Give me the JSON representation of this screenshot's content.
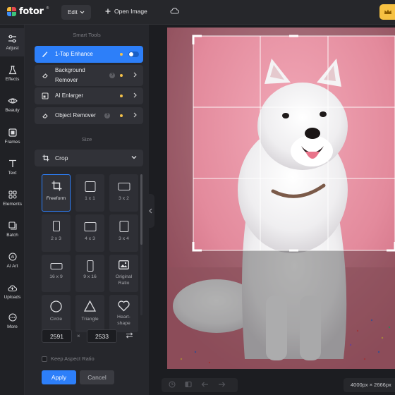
{
  "app": {
    "logo_text": "fotor",
    "logo_reg": "®",
    "logo_colors": [
      "#f5b93d",
      "#e5484d",
      "#3d8ef8",
      "#3ec57a"
    ]
  },
  "topbar": {
    "edit_label": "Edit",
    "open_image_label": "Open Image",
    "cloud_icon": "cloud-icon",
    "pro_color": "#f6c142"
  },
  "rail": {
    "items": [
      {
        "label": "Adjust",
        "icon": "sliders-icon"
      },
      {
        "label": "Effects",
        "icon": "flask-icon"
      },
      {
        "label": "Beauty",
        "icon": "eye-icon"
      },
      {
        "label": "Frames",
        "icon": "frame-icon"
      },
      {
        "label": "Text",
        "icon": "text-icon"
      },
      {
        "label": "Elements",
        "icon": "elements-icon"
      },
      {
        "label": "Batch",
        "icon": "batch-icon"
      },
      {
        "label": "AI Art",
        "icon": "ai-art-icon"
      },
      {
        "label": "Uploads",
        "icon": "upload-icon"
      },
      {
        "label": "More",
        "icon": "more-icon"
      }
    ]
  },
  "panel": {
    "smart_tools_title": "Smart Tools",
    "tools": [
      {
        "label": "1-Tap Enhance",
        "icon": "magic-wand-icon"
      },
      {
        "label": "Background Remover",
        "label_line1": "Background",
        "label_line2": "Remover",
        "icon": "eraser-icon"
      },
      {
        "label": "AI Enlarger",
        "icon": "enlarge-icon"
      },
      {
        "label": "Object Remover",
        "icon": "eraser-icon"
      }
    ],
    "size_title": "Size",
    "crop_label": "Crop",
    "ratios": [
      {
        "label": "Freeform"
      },
      {
        "label": "1 x 1"
      },
      {
        "label": "3 x 2"
      },
      {
        "label": "2 x 3"
      },
      {
        "label": "4 x 3"
      },
      {
        "label": "3 x 4"
      },
      {
        "label": "16 x 9"
      },
      {
        "label": "9 x 16"
      },
      {
        "label": "Original Ratio",
        "line1": "Original",
        "line2": "Ratio"
      },
      {
        "label": "Circle"
      },
      {
        "label": "Triangle"
      },
      {
        "label": "Heart-shape",
        "line1": "Heart-",
        "line2": "shape"
      }
    ],
    "width_value": "2591",
    "height_value": "2533",
    "times_symbol": "×",
    "keep_aspect_label": "Keep Aspect Ratio",
    "apply_label": "Apply",
    "cancel_label": "Cancel"
  },
  "canvas": {
    "size_text": "4000px × 2666px",
    "accent": "#2d7ff9"
  }
}
